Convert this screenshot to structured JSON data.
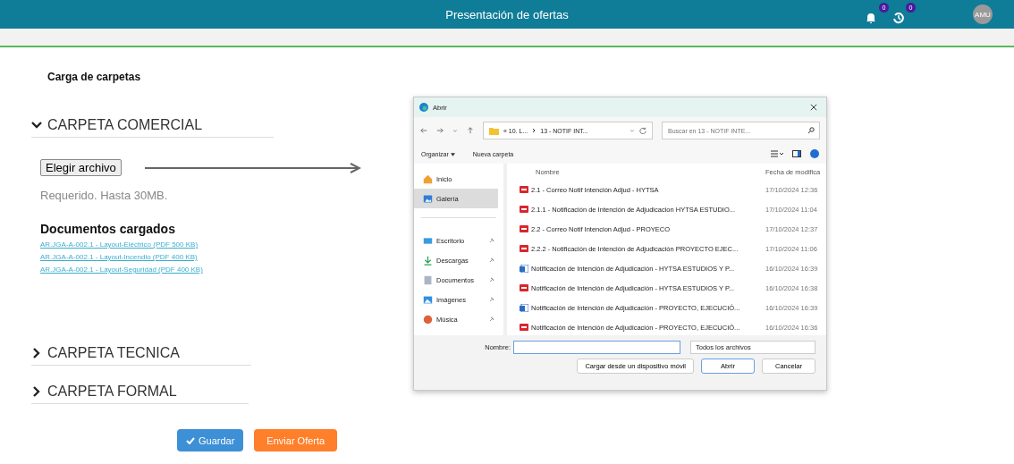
{
  "header": {
    "title": "Presentación de ofertas",
    "notifications": [
      {
        "kind": "bell",
        "count": "0"
      },
      {
        "kind": "history",
        "count": "0"
      }
    ],
    "avatar": "AMU"
  },
  "page": {
    "heading": "Carga de carpetas",
    "sections": [
      {
        "title": "CARPETA COMERCIAL",
        "expanded": true,
        "upload": {
          "button": "Elegir archivo",
          "hint": "Requerido. Hasta 30MB.",
          "uploaded_title": "Documentos cargados",
          "documents": [
            "AR.JGA-A-002.1 - Layout-Eléctrico (PDF 500 KB)",
            "AR.JGA-A-002.1 - Layout-Incendio (PDF 400 KB)",
            "AR.JGA-A-002.1 - Layout-Seguridad (PDF 400 KB)"
          ]
        }
      },
      {
        "title": "CARPETA TECNICA",
        "expanded": false
      },
      {
        "title": "CARPETA FORMAL",
        "expanded": false
      }
    ],
    "buttons": [
      {
        "label": "Guardar",
        "kind": "save"
      },
      {
        "label": "Enviar Oferta",
        "kind": "send"
      }
    ]
  },
  "dialog": {
    "title": "Abrir",
    "breadcrumb": [
      "« 10. L...",
      "13 - NOTIF INT..."
    ],
    "search": {
      "placeholder": "Buscar en 13 - NOTIF INTE..."
    },
    "toolbar": [
      "Organizar",
      "Nueva carpeta"
    ],
    "sidebar": [
      {
        "label": "Inicio",
        "kind": "home",
        "pinned": false,
        "selected": false
      },
      {
        "label": "Galería",
        "kind": "gallery",
        "pinned": false,
        "selected": true
      },
      {
        "label": "Escritorio",
        "kind": "desktop",
        "pinned": true,
        "selected": false
      },
      {
        "label": "Descargas",
        "kind": "downloads",
        "pinned": true,
        "selected": false
      },
      {
        "label": "Documentos",
        "kind": "documents",
        "pinned": true,
        "selected": false
      },
      {
        "label": "Imágenes",
        "kind": "pictures",
        "pinned": true,
        "selected": false
      },
      {
        "label": "Música",
        "kind": "music",
        "pinned": true,
        "selected": false
      }
    ],
    "columns": [
      "Nombre",
      "Fecha de modifica"
    ],
    "files": [
      {
        "name": "2.1 - Correo Notif Intención Adjud - HYTSA",
        "date": "17/10/2024 12:36",
        "kind": "pdf"
      },
      {
        "name": "2.1.1 - Notificación de Intención de Adjudicacion HYTSA ESTUDIO...",
        "date": "17/10/2024 11:04",
        "kind": "pdf"
      },
      {
        "name": "2.2 - Correo Notif Intencion Adjud - PROYECO",
        "date": "17/10/2024 12:37",
        "kind": "pdf"
      },
      {
        "name": "2.2.2 - Notificación de Intención de Adjudicación PROYECTO EJEC...",
        "date": "17/10/2024 11:06",
        "kind": "pdf"
      },
      {
        "name": "Notificación de Intención de Adjudicación - HYTSA ESTUDIOS Y P...",
        "date": "16/10/2024 16:39",
        "kind": "word"
      },
      {
        "name": "Notificación de Intención de Adjudicación - HYTSA ESTUDIOS Y P...",
        "date": "16/10/2024 16:38",
        "kind": "pdf"
      },
      {
        "name": "Notificación de Intención de Adjudicación - PROYECTO, EJECUCIÓ...",
        "date": "16/10/2024 16:39",
        "kind": "word"
      },
      {
        "name": "Notificación de Intención de Adjudicación - PROYECTO, EJECUCIÓ...",
        "date": "16/10/2024 16:36",
        "kind": "pdf"
      }
    ],
    "filename_label": "Nombre:",
    "filter": "Todos los archivos",
    "buttons": [
      "Cargar desde un dispositivo móvil",
      "Abrir",
      "Cancelar"
    ]
  }
}
